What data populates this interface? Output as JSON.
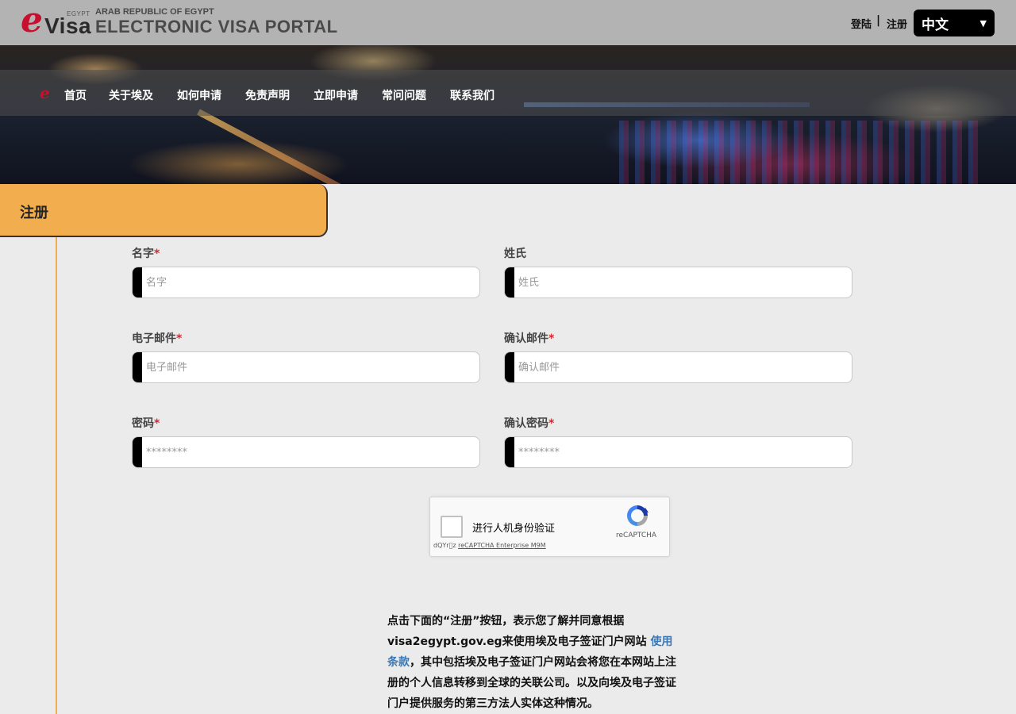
{
  "header": {
    "logo_e": "e",
    "logo_visa": "Visa",
    "logo_egypt": "EGYPT",
    "portal_subtitle": "ARAB REPUBLIC OF EGYPT",
    "portal_title": "ELECTRONIC VISA PORTAL",
    "login_label": "登陆",
    "separator": "|",
    "register_label": "注册",
    "language": "中文"
  },
  "nav": {
    "items": [
      "首页",
      "关于埃及",
      "如何申请",
      "免责声明",
      "立即申请",
      "常问问题",
      "联系我们"
    ]
  },
  "section": {
    "title": "注册"
  },
  "form": {
    "first_name": {
      "label": "名字",
      "required": "*",
      "placeholder": "名字"
    },
    "last_name": {
      "label": "姓氏",
      "placeholder": "姓氏"
    },
    "email": {
      "label": "电子邮件",
      "required": "*",
      "placeholder": "电子邮件"
    },
    "confirm_email": {
      "label": "确认邮件",
      "required": "*",
      "placeholder": "确认邮件"
    },
    "password": {
      "label": "密码",
      "required": "*",
      "placeholder": "********"
    },
    "confirm_password": {
      "label": "确认密码",
      "required": "*",
      "placeholder": "********"
    }
  },
  "recaptcha": {
    "label": "进行人机身份验证",
    "brand": "reCAPTCHA",
    "footer_prefix": "dQYr\u0000z ",
    "footer_link": "reCAPTCHA Enterprise M9M"
  },
  "terms": {
    "text_before": "点击下面的“注册”按钮，表示您了解并同意根据 visa2egypt.gov.eg来使用埃及电子签证门户网站 ",
    "link": "使用条款",
    "text_after": "，其中包括埃及电子签证门户网站会将您在本网站上注册的个人信息转移到全球的关联公司。以及向埃及电子签证门户提供服务的第三方法人实体这种情况。"
  },
  "colors": {
    "accent": "#f1ad4e",
    "brand_red": "#c8102e",
    "link": "#3a78b5",
    "required": "#d9262c"
  }
}
